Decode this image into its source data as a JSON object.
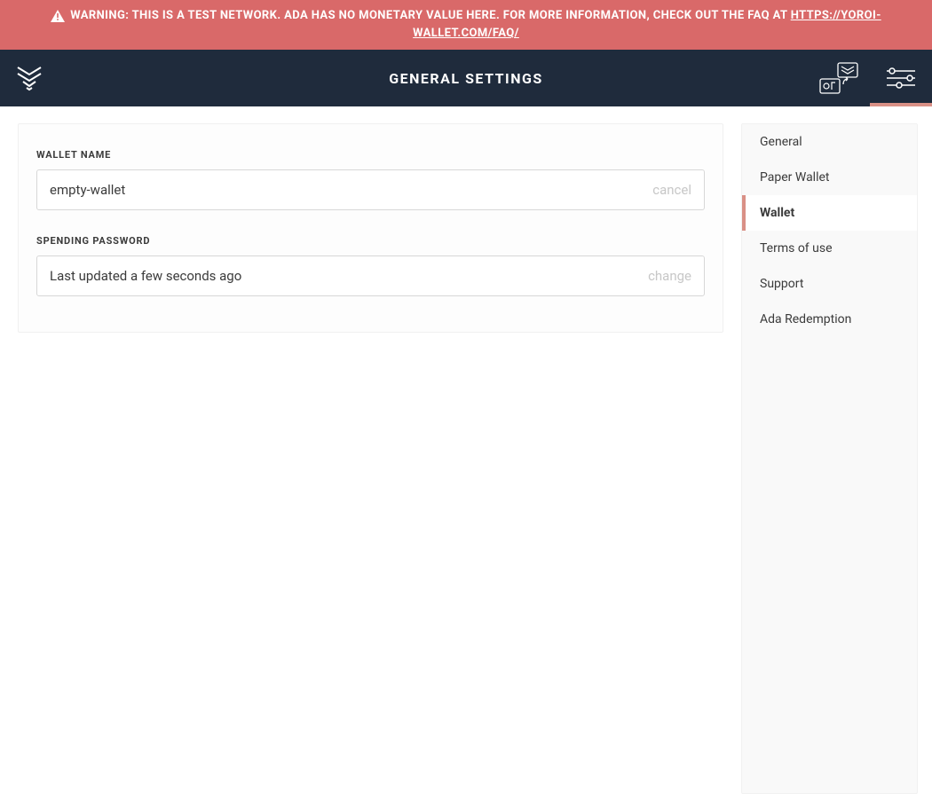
{
  "banner": {
    "text": "WARNING: THIS IS A TEST NETWORK. ADA HAS NO MONETARY VALUE HERE. FOR MORE INFORMATION, CHECK OUT THE FAQ AT ",
    "link_text": "HTTPS://YOROI-WALLET.COM/FAQ/"
  },
  "header": {
    "title": "GENERAL SETTINGS"
  },
  "main": {
    "wallet_name": {
      "label": "WALLET NAME",
      "value": "empty-wallet",
      "action": "cancel"
    },
    "spending_password": {
      "label": "SPENDING PASSWORD",
      "value": "Last updated a few seconds ago",
      "action": "change"
    }
  },
  "sidebar": {
    "items": [
      {
        "label": "General",
        "active": false
      },
      {
        "label": "Paper Wallet",
        "active": false
      },
      {
        "label": "Wallet",
        "active": true
      },
      {
        "label": "Terms of use",
        "active": false
      },
      {
        "label": "Support",
        "active": false
      },
      {
        "label": "Ada Redemption",
        "active": false
      }
    ]
  }
}
